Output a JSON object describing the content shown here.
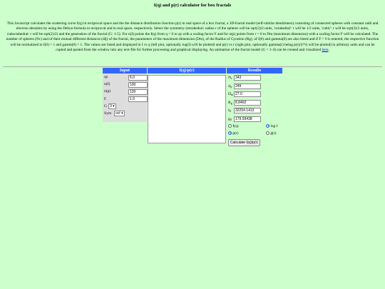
{
  "page": {
    "title": "I(q) and p(r) calculator for box fractals",
    "intro_text": "This Javascript calculates the scattering curve I(q) in reciprocal space and the the distance distribution function p(r) in real space of a box fractal, a 3D-fractal model (self-similar dendrimers) consisting of connected spheres with constant radii and electron densities by using the Debye-formula in reciprocal and in real space, respectively. Select the symmetry (tetrahedral: radius r of the spheres will be sqrt(3)/2 units, 'octahedral': r will be 1/2 units, 'cubic': r will be sqrt(3)/2 units, cuboctahedral: r will be sqrt(2)/2) and the generation of the fractal (G: 1-5). For n(I) points the I(q) from q = 0 to qz with a scaling factor F and for n(p) points from r = 0 to Dm (maximum dimension) with a scaling factor F will be calculated. The number of spheres (Nc) and of their mutual different distances (dij) of the fractal, the parameters of the maximum dimension (Dm), of the Radius of Gyration (Rg), of I(0) and gamma(0) are also listed and if F = 0 is entered, the respective function will be normalized to I(0) = 1 and gamm(0) = 1. The values are listed and displayed in I vs q (left plot, optionally log(I) will be plotted) and p(r) vs r (right plot, optionally gamma(r) being p(r)/(r*r) will be plotted) in arbitrary units and can be copied and pasted from the window into any text-file for further processing and graphical displaying. An animation of the fractal model (G = 1-4) can be created and visualized",
    "intro_link": "here",
    "intro_end": "."
  },
  "input": {
    "header": "Input",
    "qz_label": "qz",
    "qz_value": "5.0",
    "nI_label": "n(I)",
    "nI_value": "100",
    "np_label": "n(p)",
    "np_value": "120",
    "F_label": "F",
    "F_value": "1.0",
    "G_label": "G",
    "G_value": "3",
    "sym_label": "Sym",
    "sym_value": "oct"
  },
  "output": {
    "header": "I(q)/p(r)"
  },
  "results": {
    "header": "Results",
    "Nc_base": "N",
    "Nc_sub": "c",
    "Nc_value": "343",
    "dij_base": "d",
    "dij_sub": "ij",
    "dij_value": "249",
    "Dm_base": "D",
    "Dm_sub": "m",
    "Dm_value": "27.0",
    "Rg_base": "R",
    "Rg_sub": "g",
    "Rg_value": "8.8402",
    "I0_base": "I",
    "I0_sub": "0",
    "I0_value": "32254.1413",
    "g0_base": "g",
    "g0_sub": "0",
    "g0_value": "179.59438",
    "opt_Iq": "I(q)",
    "opt_logI": "log I",
    "opt_pr": "p(r)",
    "opt_gr": "g(r)",
    "calc_button": "Calculate I(q)/p(r)"
  }
}
